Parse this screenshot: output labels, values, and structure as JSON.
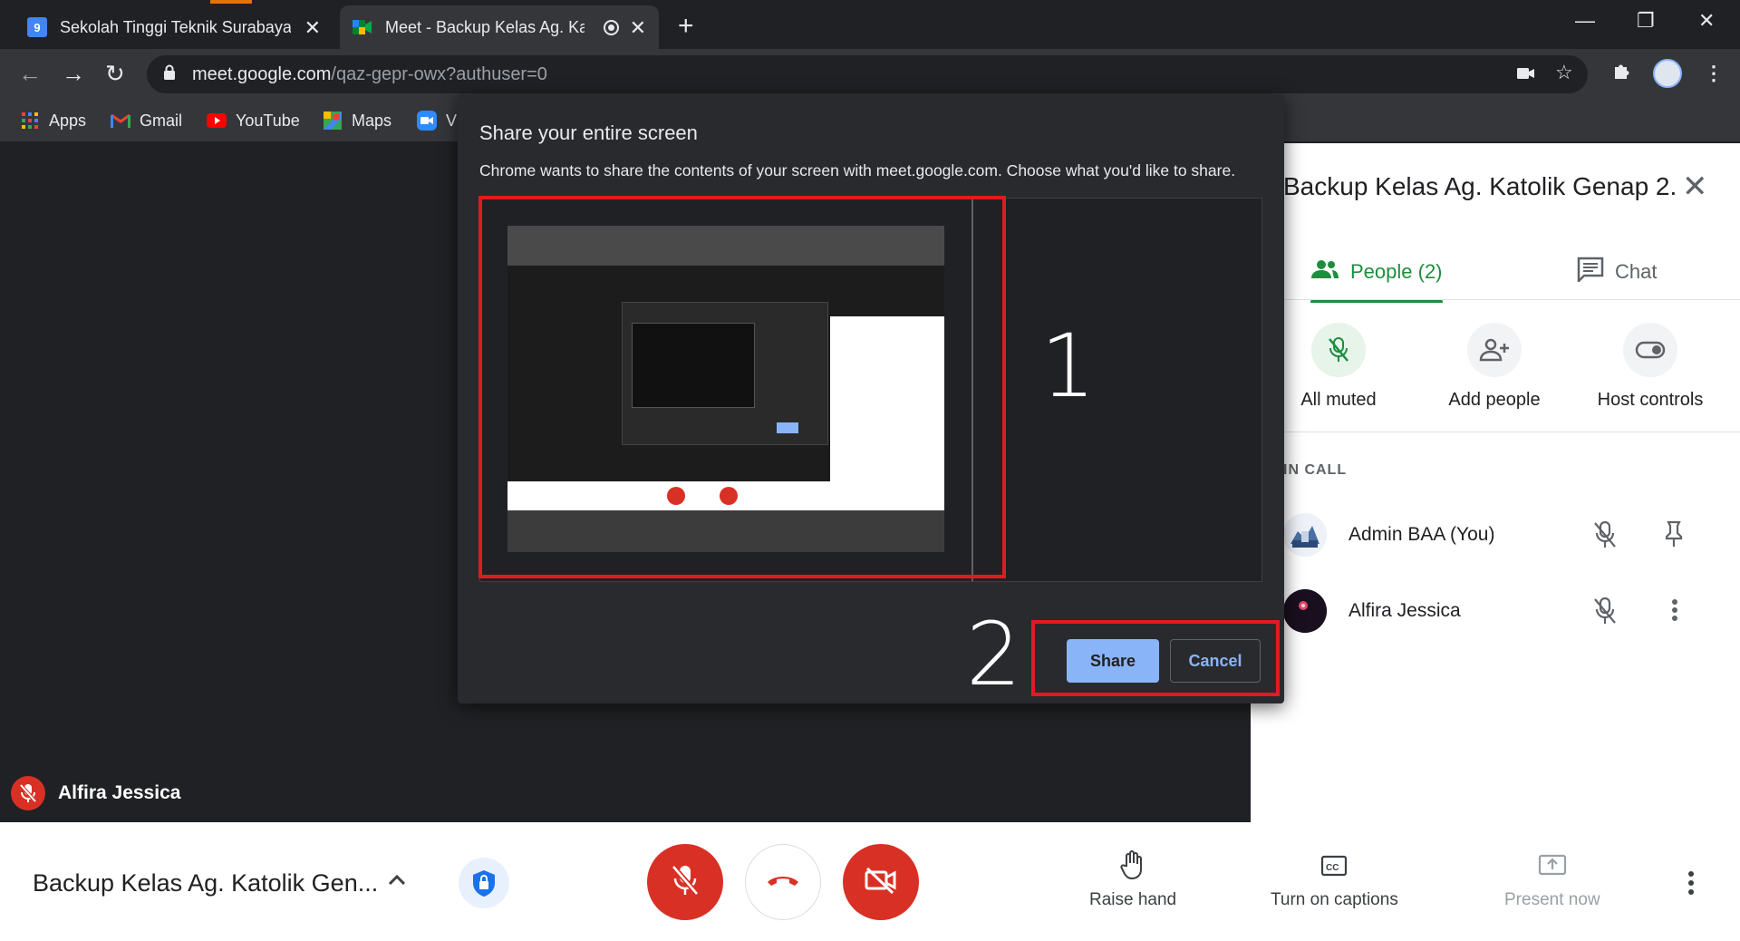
{
  "browser": {
    "tabs": [
      {
        "title": "Sekolah Tinggi Teknik Surabaya -",
        "favicon": "calendar-icon",
        "favicon_text": "9"
      },
      {
        "title": "Meet - Backup Kelas Ag. Katolik",
        "favicon": "meet-icon"
      }
    ],
    "url_host": "meet.google.com",
    "url_path": "/qaz-gepr-owx?authuser=0",
    "bookmarks": [
      {
        "label": "Apps",
        "icon": "apps-grid-icon"
      },
      {
        "label": "Gmail",
        "icon": "gmail-icon"
      },
      {
        "label": "YouTube",
        "icon": "youtube-icon"
      },
      {
        "label": "Maps",
        "icon": "maps-icon"
      },
      {
        "label": "V",
        "icon": "zoom-icon"
      }
    ]
  },
  "dialog": {
    "title": "Share your entire screen",
    "message": "Chrome wants to share the contents of your screen with meet.google.com. Choose what you'd like to share.",
    "share_label": "Share",
    "cancel_label": "Cancel"
  },
  "annotations": {
    "step1": "1",
    "step2": "2",
    "box_color": "#e01b24"
  },
  "self_tile": {
    "name": "Alfira Jessica"
  },
  "panel": {
    "title": "Backup Kelas Ag. Katolik Genap 2...",
    "tab_people": "People (2)",
    "tab_chat": "Chat",
    "actions": [
      {
        "label": "All muted",
        "icon": "mic-off-icon"
      },
      {
        "label": "Add people",
        "icon": "add-person-icon"
      },
      {
        "label": "Host controls",
        "icon": "toggle-icon"
      }
    ],
    "section_label": "IN CALL",
    "participants": [
      {
        "name": "Admin BAA (You)"
      },
      {
        "name": "Alfira Jessica"
      }
    ]
  },
  "bottom": {
    "meeting_title": "Backup Kelas Ag. Katolik Gen...",
    "raise_hand": "Raise hand",
    "captions": "Turn on captions",
    "present": "Present now"
  },
  "colors": {
    "accent_green": "#1e8e3e",
    "danger_red": "#d93025",
    "chrome_dark": "#202124",
    "link_blue": "#8ab4f8"
  }
}
